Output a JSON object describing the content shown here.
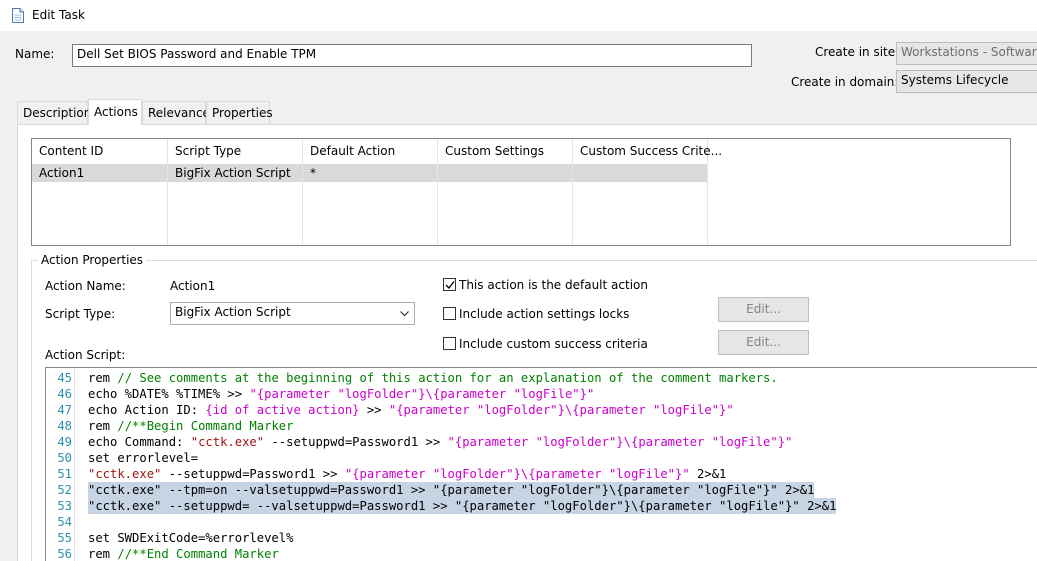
{
  "window": {
    "title": "Edit Task",
    "icon": "document-icon"
  },
  "form": {
    "name_label": "Name:",
    "name_value": "Dell Set BIOS Password and Enable TPM",
    "site_label": "Create in site:",
    "site_value": "Workstations - Software",
    "domain_label": "Create in domain:",
    "domain_value": "Systems Lifecycle"
  },
  "tabs": [
    {
      "label": "Description"
    },
    {
      "label": "Actions"
    },
    {
      "label": "Relevance"
    },
    {
      "label": "Properties"
    }
  ],
  "active_tab": "Actions",
  "actions_table": {
    "columns": [
      "Content ID",
      "Script Type",
      "Default Action",
      "Custom Settings",
      "Custom Success Crite..."
    ],
    "rows": [
      [
        "Action1",
        "BigFix Action Script",
        "*",
        "",
        ""
      ]
    ]
  },
  "action_properties": {
    "group_title": "Action Properties",
    "action_name_label": "Action Name:",
    "action_name_value": "Action1",
    "script_type_label": "Script Type:",
    "script_type_value": "BigFix Action Script",
    "default_action_label": "This action is the default action",
    "default_action_checked": true,
    "settings_locks_label": "Include action settings locks",
    "settings_locks_checked": false,
    "success_criteria_label": "Include custom success criteria",
    "success_criteria_checked": false,
    "edit_label": "Edit...",
    "script_label": "Action Script:"
  },
  "script_lines": [
    {
      "num": "45",
      "parts": [
        [
          "t",
          "rem "
        ],
        [
          "c",
          "// See comments at the beginning of this action for an explanation of the comment markers."
        ]
      ]
    },
    {
      "num": "46",
      "parts": [
        [
          "t",
          "echo %DATE% %TIME% >> "
        ],
        [
          "r",
          "\"{parameter \"logFolder\"}\\{parameter \"logFile\"}\""
        ]
      ]
    },
    {
      "num": "47",
      "parts": [
        [
          "t",
          "echo Action ID: "
        ],
        [
          "r",
          "{id of active action}"
        ],
        [
          "t",
          " >> "
        ],
        [
          "r",
          "\"{parameter \"logFolder\"}\\{parameter \"logFile\"}\""
        ]
      ]
    },
    {
      "num": "48",
      "parts": [
        [
          "t",
          "rem "
        ],
        [
          "c",
          "//**Begin Command Marker"
        ]
      ]
    },
    {
      "num": "49",
      "parts": [
        [
          "t",
          "echo Command: "
        ],
        [
          "s",
          "\"cctk.exe\""
        ],
        [
          "t",
          " --setuppwd=Password1 >> "
        ],
        [
          "r",
          "\"{parameter \"logFolder\"}\\{parameter \"logFile\"}\""
        ]
      ]
    },
    {
      "num": "50",
      "parts": [
        [
          "t",
          "set errorlevel="
        ]
      ]
    },
    {
      "num": "51",
      "parts": [
        [
          "s",
          "\"cctk.exe\""
        ],
        [
          "t",
          " --setuppwd=Password1 >> "
        ],
        [
          "r",
          "\"{parameter \"logFolder\"}\\{parameter \"logFile\"}\""
        ],
        [
          "t",
          " 2>&1"
        ]
      ]
    },
    {
      "num": "52",
      "selected": true,
      "parts": [
        [
          "t",
          "\"cctk.exe\" --tpm=on --valsetuppwd=Password1 >> \"{parameter \"logFolder\"}\\{parameter \"logFile\"}\" 2>&1"
        ]
      ]
    },
    {
      "num": "53",
      "selected": true,
      "parts": [
        [
          "t",
          "\"cctk.exe\" --setuppwd= --valsetuppwd=Password1 >> \"{parameter \"logFolder\"}\\{parameter \"logFile\"}\" 2>&1"
        ]
      ]
    },
    {
      "num": "54",
      "parts": []
    },
    {
      "num": "55",
      "parts": [
        [
          "t",
          "set SWDExitCode=%errorlevel%"
        ]
      ]
    },
    {
      "num": "56",
      "parts": [
        [
          "t",
          "rem "
        ],
        [
          "c",
          "//**End Command Marker"
        ]
      ]
    }
  ],
  "colors": {
    "comment": "#008000",
    "relevance": "#cc00cc",
    "string": "#a31515",
    "line_number": "#2b91af",
    "selection": "#c7d4e3",
    "row_selected": "#d9d9d9"
  }
}
